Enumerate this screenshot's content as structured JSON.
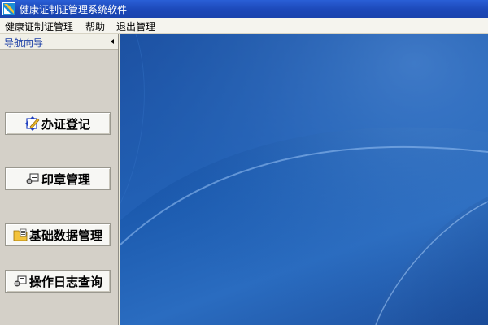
{
  "window": {
    "title": "健康证制证管理系统软件"
  },
  "menu": [
    "健康证制证管理",
    "帮助",
    "退出管理"
  ],
  "nav": {
    "title": "导航向导",
    "buttons": [
      {
        "label": "办证登记"
      },
      {
        "label": "印章管理"
      },
      {
        "label": "基础数据管理"
      },
      {
        "label": "操作日志查询"
      }
    ]
  },
  "colors": {
    "titlebar": "#1c48b8",
    "desktop": "#1d5cb0",
    "nav_title": "#1b3fa6"
  }
}
